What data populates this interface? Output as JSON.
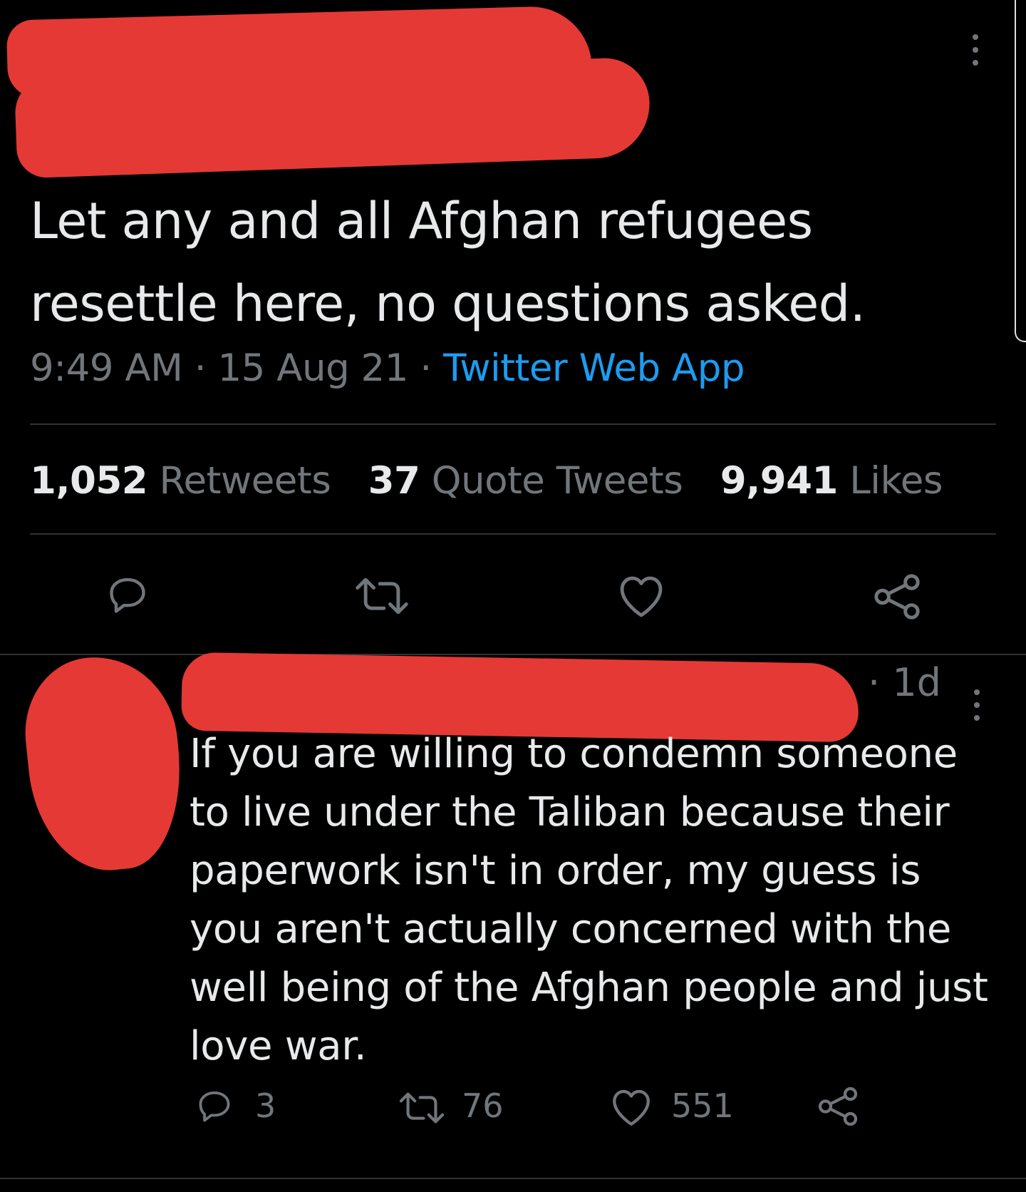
{
  "main_tweet": {
    "text": "Let any and all Afghan refugees resettle here, no questions asked.",
    "time": "9:49 AM",
    "separator": "·",
    "date": "15 Aug 21",
    "app": "Twitter Web App",
    "stats": {
      "retweets_count": "1,052",
      "retweets_label": "Retweets",
      "quotes_count": "37",
      "quotes_label": "Quote Tweets",
      "likes_count": "9,941",
      "likes_label": "Likes"
    }
  },
  "reply": {
    "age": "· 1d",
    "text": "If you are willing to condemn someone to live under the Taliban because their paperwork isn't in order, my guess is you aren't actually concerned with the well being of the Afghan people and just love war.",
    "replies": "3",
    "retweets": "76",
    "likes": "551"
  },
  "icons": [
    "more-icon",
    "reply-icon",
    "retweet-icon",
    "like-icon",
    "share-icon"
  ],
  "colors": {
    "background": "#000000",
    "text": "#e7e9ea",
    "secondary": "#71767b",
    "accent": "#1d9bf0",
    "divider": "#2f3336",
    "redaction": "#e53935"
  }
}
